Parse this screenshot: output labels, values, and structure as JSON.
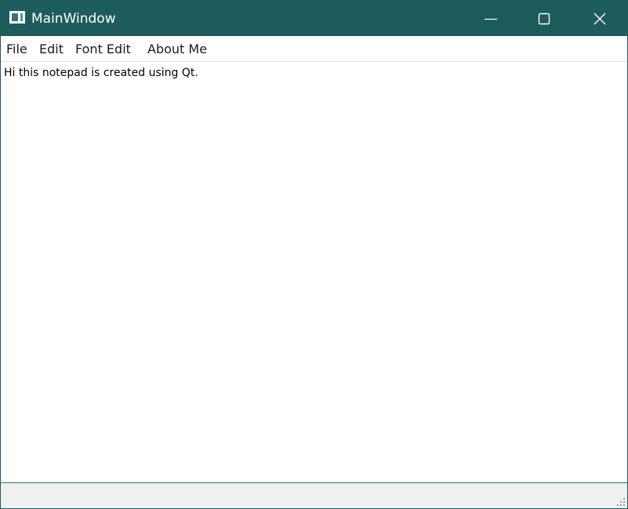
{
  "window": {
    "title": "MainWindow",
    "accent_color": "#1d5c5d"
  },
  "titlebar_icons": {
    "app": "app-window-icon",
    "minimize": "minimize-icon",
    "maximize": "maximize-icon",
    "close": "close-icon"
  },
  "menu": {
    "items": [
      {
        "label": "File"
      },
      {
        "label": "Edit"
      },
      {
        "label": "Font Edit"
      },
      {
        "label": "About Me"
      }
    ]
  },
  "editor": {
    "text": "Hi this notepad is created using Qt."
  },
  "statusbar": {
    "grip_icon": "resize-grip-icon"
  }
}
